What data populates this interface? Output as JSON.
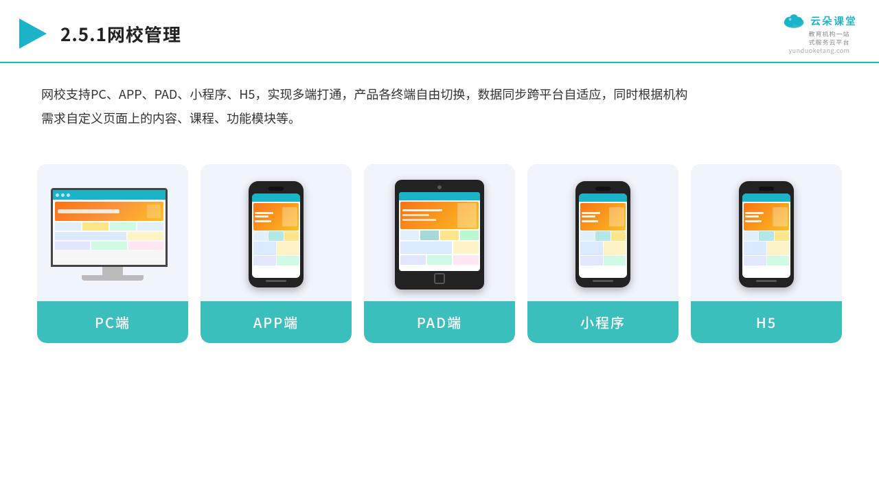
{
  "header": {
    "title": "2.5.1网校管理",
    "logo": {
      "cn_name": "云朵课堂",
      "url": "yunduoketang.com",
      "subtitle_line1": "教育机构一站",
      "subtitle_line2": "式服务云平台"
    }
  },
  "description": {
    "text": "网校支持PC、APP、PAD、小程序、H5，实现多端打通，产品各终端自由切换，数据同步跨平台自适应，同时根据机构需求自定义页面上的内容、课程、功能模块等。"
  },
  "cards": [
    {
      "id": "pc",
      "label": "PC端"
    },
    {
      "id": "app",
      "label": "APP端"
    },
    {
      "id": "pad",
      "label": "PAD端"
    },
    {
      "id": "miniapp",
      "label": "小程序"
    },
    {
      "id": "h5",
      "label": "H5"
    }
  ],
  "colors": {
    "accent": "#1ab3c8",
    "card_bg": "#f0f4fb",
    "card_label_bg": "#3bbfbc",
    "header_border": "#1ab3c8"
  }
}
